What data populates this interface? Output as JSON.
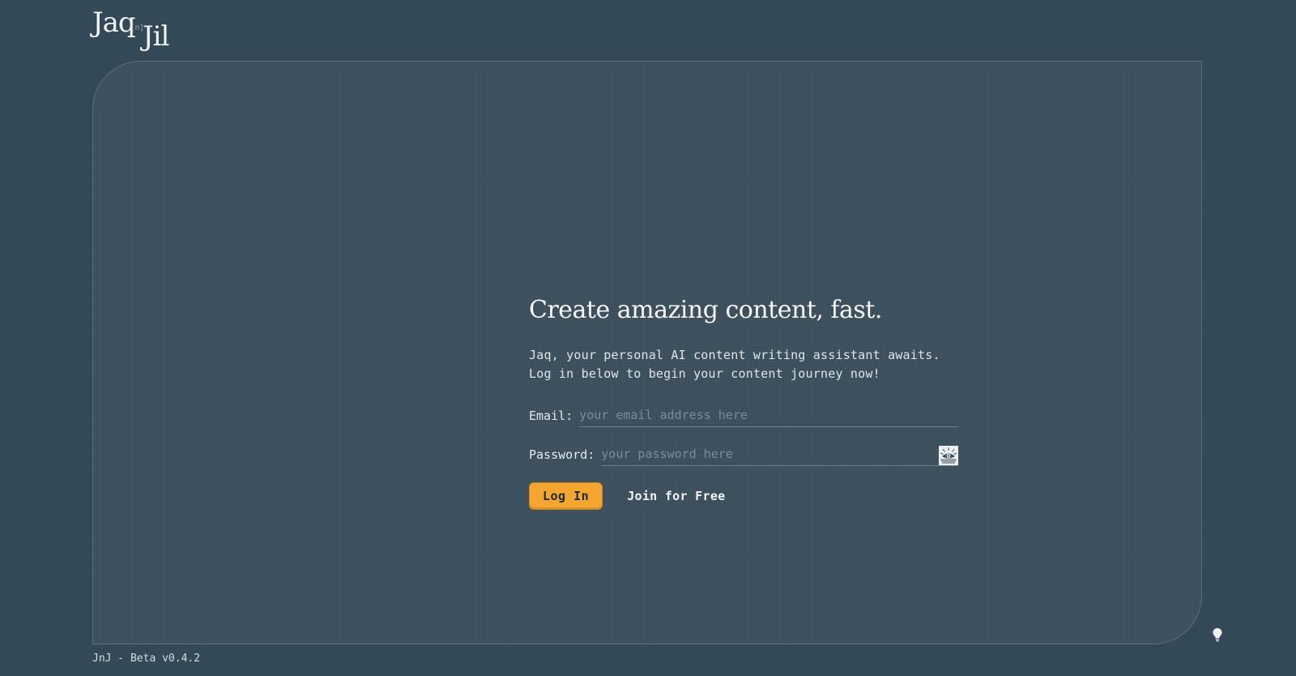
{
  "logo": {
    "part1": "Jaq",
    "connector": "[n]",
    "part2": "Jil"
  },
  "login": {
    "headline": "Create amazing content, fast.",
    "subtitle_line1": "Jaq, your personal AI content writing assistant awaits.",
    "subtitle_line2": "Log in below to begin your content journey now!",
    "email_label": "Email:",
    "email_placeholder": "your email address here",
    "email_value": "",
    "password_label": "Password:",
    "password_placeholder": "your password here",
    "password_value": "",
    "show_password_icon": "eye-icon",
    "login_button": "Log In",
    "join_link": "Join for Free"
  },
  "theme_toggle_icon": "lightbulb-icon",
  "footer": {
    "version": "JnJ - Beta v0.4.2"
  },
  "colors": {
    "background": "#344958",
    "card": "#3c4f5c",
    "accent": "#f4a630"
  }
}
